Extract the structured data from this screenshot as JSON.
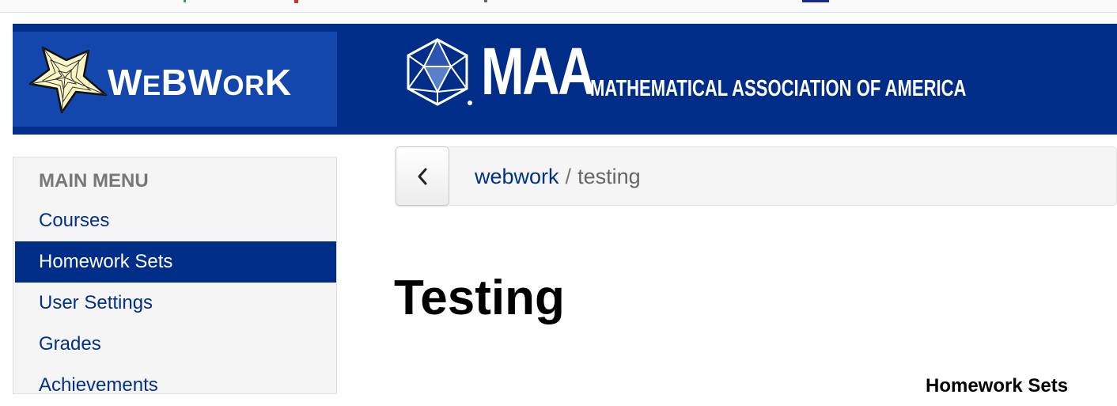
{
  "header": {
    "webwork_logo_text": "WEBWORK",
    "maa_letters": "MAA",
    "maa_name": "MATHEMATICAL ASSOCIATION OF AMERICA"
  },
  "sidebar": {
    "title": "MAIN MENU",
    "items": [
      {
        "label": "Courses",
        "active": false
      },
      {
        "label": "Homework Sets",
        "active": true
      },
      {
        "label": "User Settings",
        "active": false
      },
      {
        "label": "Grades",
        "active": false
      },
      {
        "label": "Achievements",
        "active": false
      }
    ]
  },
  "breadcrumb": {
    "parent": "webwork",
    "separator": "/",
    "current": "testing"
  },
  "main": {
    "title": "Testing",
    "section_heading": "Homework Sets"
  },
  "colors": {
    "banner_bg": "#002d87",
    "logo_bg": "#1347ad",
    "link": "#003087",
    "active_bg": "#002d87"
  }
}
